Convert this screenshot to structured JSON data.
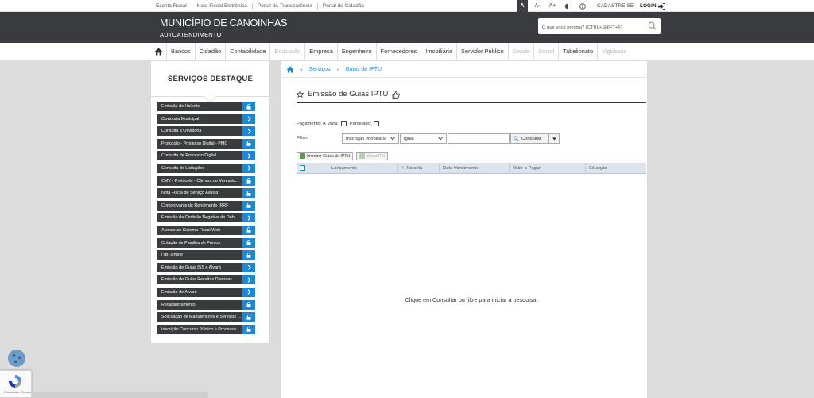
{
  "topbar": {
    "links": [
      "Escrita Fiscal",
      "Nota Fiscal Eletrônica",
      "Portal da Transparência",
      "Portal do Cidadão"
    ],
    "font_buttons": [
      "A",
      "A-",
      "A+"
    ],
    "signup": "CADASTRE-SE",
    "login": "LOGIN"
  },
  "header": {
    "title": "MUNICÍPIO DE CANOINHAS",
    "subtitle": "AUTOATENDIMENTO",
    "search_placeholder": "O que você precisa? (CTRL+SHIFT+F)"
  },
  "nav": {
    "items": [
      {
        "label": "Bancos",
        "enabled": true
      },
      {
        "label": "Cidadão",
        "enabled": true
      },
      {
        "label": "Contabilidade",
        "enabled": true
      },
      {
        "label": "Educação",
        "enabled": false
      },
      {
        "label": "Empresa",
        "enabled": true
      },
      {
        "label": "Engenheiro",
        "enabled": true
      },
      {
        "label": "Fornecedores",
        "enabled": true
      },
      {
        "label": "Imobiliária",
        "enabled": true
      },
      {
        "label": "Servidor Público",
        "enabled": true
      },
      {
        "label": "Saúde",
        "enabled": false
      },
      {
        "label": "Social",
        "enabled": false
      },
      {
        "label": "Tabelionato",
        "enabled": true
      },
      {
        "label": "Vigilância",
        "enabled": false
      }
    ]
  },
  "sidebar": {
    "title": "SERVIÇOS DESTAQUE",
    "services": [
      {
        "label": "Emissão de Holerite",
        "icon": "lock"
      },
      {
        "label": "Ouvidoria Municipal",
        "icon": "arrow"
      },
      {
        "label": "Consulta a Ouvidoria",
        "icon": "arrow"
      },
      {
        "label": "Protocolo - Processo Digital - PMC",
        "icon": "lock"
      },
      {
        "label": "Consulta de Processo Digital",
        "icon": "arrow"
      },
      {
        "label": "Consulta de Licitações",
        "icon": "arrow"
      },
      {
        "label": "CMV - Protocolo - Câmara de Vereado...",
        "icon": "lock"
      },
      {
        "label": "Nota Fiscal de Serviço Avulsa",
        "icon": "lock"
      },
      {
        "label": "Comprovante de Rendimento IRRF",
        "icon": "lock"
      },
      {
        "label": "Emissão da Certidão Negativa de Débi...",
        "icon": "arrow"
      },
      {
        "label": "Acesso ao Sistema Fiscal Web",
        "icon": "lock"
      },
      {
        "label": "Cotação de Planilha de Preços",
        "icon": "lock"
      },
      {
        "label": "ITBI Online",
        "icon": "lock"
      },
      {
        "label": "Emissão de Guias ISS e Alvará",
        "icon": "arrow"
      },
      {
        "label": "Emissão de Guias Receitas Diversas",
        "icon": "arrow"
      },
      {
        "label": "Emissão de Alvará",
        "icon": "arrow"
      },
      {
        "label": "Recadastramento",
        "icon": "lock"
      },
      {
        "label": "Solicitação de Manutenções e Serviços ...",
        "icon": "lock"
      },
      {
        "label": "Inscrição Concurso Público e Processo ...",
        "icon": "lock"
      }
    ]
  },
  "breadcrumb": [
    "Serviços",
    "Guias de IPTU"
  ],
  "page": {
    "title": "Emissão de Guias IPTU",
    "payment_label": "Pagamento: À Vista:",
    "installment_label": "Parcelado:",
    "filter_label": "Filtro:",
    "filter_field": "Inscrição Imobiliária",
    "filter_operator": "Igual",
    "filter_value": "",
    "consult_button": "Consultar",
    "print_button": "Imprimir Guias de IPTU",
    "pix_button": "Gerar PIX",
    "columns": [
      "Lançamento",
      "Parcela",
      "Data Vencimento",
      "Valor a Pagar",
      "Situação"
    ],
    "empty_message": "Clique em Consultar ou filtre para iniciar a pesquisa."
  },
  "recaptcha": {
    "terms": "Privacidade - Termos"
  },
  "colors": {
    "header": "#3a3b3f",
    "accent": "#1a88d6"
  }
}
